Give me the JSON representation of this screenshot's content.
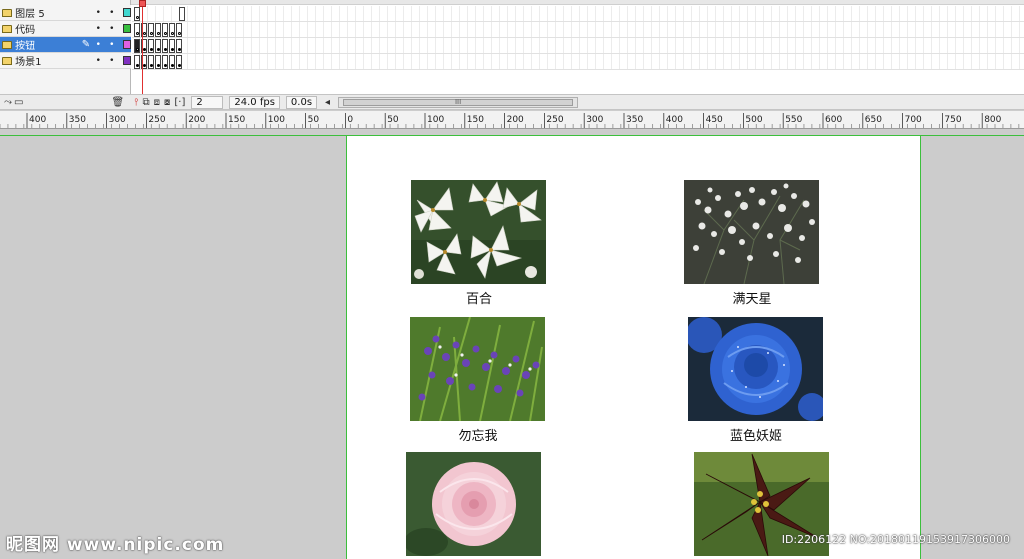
{
  "timeline": {
    "layers": [
      {
        "name": "图层 5",
        "color": "#40d8d0",
        "selected": false
      },
      {
        "name": "代码",
        "color": "#38c040",
        "selected": false
      },
      {
        "name": "按钮",
        "color": "#e060e0",
        "selected": true
      },
      {
        "name": "场景1",
        "color": "#8030c0",
        "selected": false
      }
    ],
    "visible_dot": "•",
    "pencil_icon": "✎",
    "current_frame": "2",
    "frame_rate": "24.0 fps",
    "elapsed_time": "0.0s",
    "scroll_grip": "III",
    "scroll_left_arrow": "◂"
  },
  "ruler": {
    "labels": [
      "400",
      "350",
      "300",
      "250",
      "200",
      "150",
      "100",
      "50",
      "0",
      "50",
      "100",
      "150",
      "200",
      "250",
      "300",
      "350",
      "400",
      "450",
      "500",
      "550",
      "600",
      "650",
      "700",
      "750",
      "800"
    ]
  },
  "stage": {
    "flowers": [
      {
        "label": "百合",
        "img": "lily"
      },
      {
        "label": "满天星",
        "img": "babys-breath"
      },
      {
        "label": "勿忘我",
        "img": "forget-me-not"
      },
      {
        "label": "蓝色妖姬",
        "img": "blue-rose"
      },
      {
        "label": "",
        "img": "camellia"
      },
      {
        "label": "",
        "img": "dark-lily"
      }
    ]
  },
  "watermark": {
    "left": "昵图网 www.nipic.com",
    "right": "ID:2206122 NO:20180119153917306000"
  },
  "colors": {
    "stage_border": "#3cbf3c",
    "selected_layer": "#3c7fd6",
    "playhead": "#e03030"
  }
}
